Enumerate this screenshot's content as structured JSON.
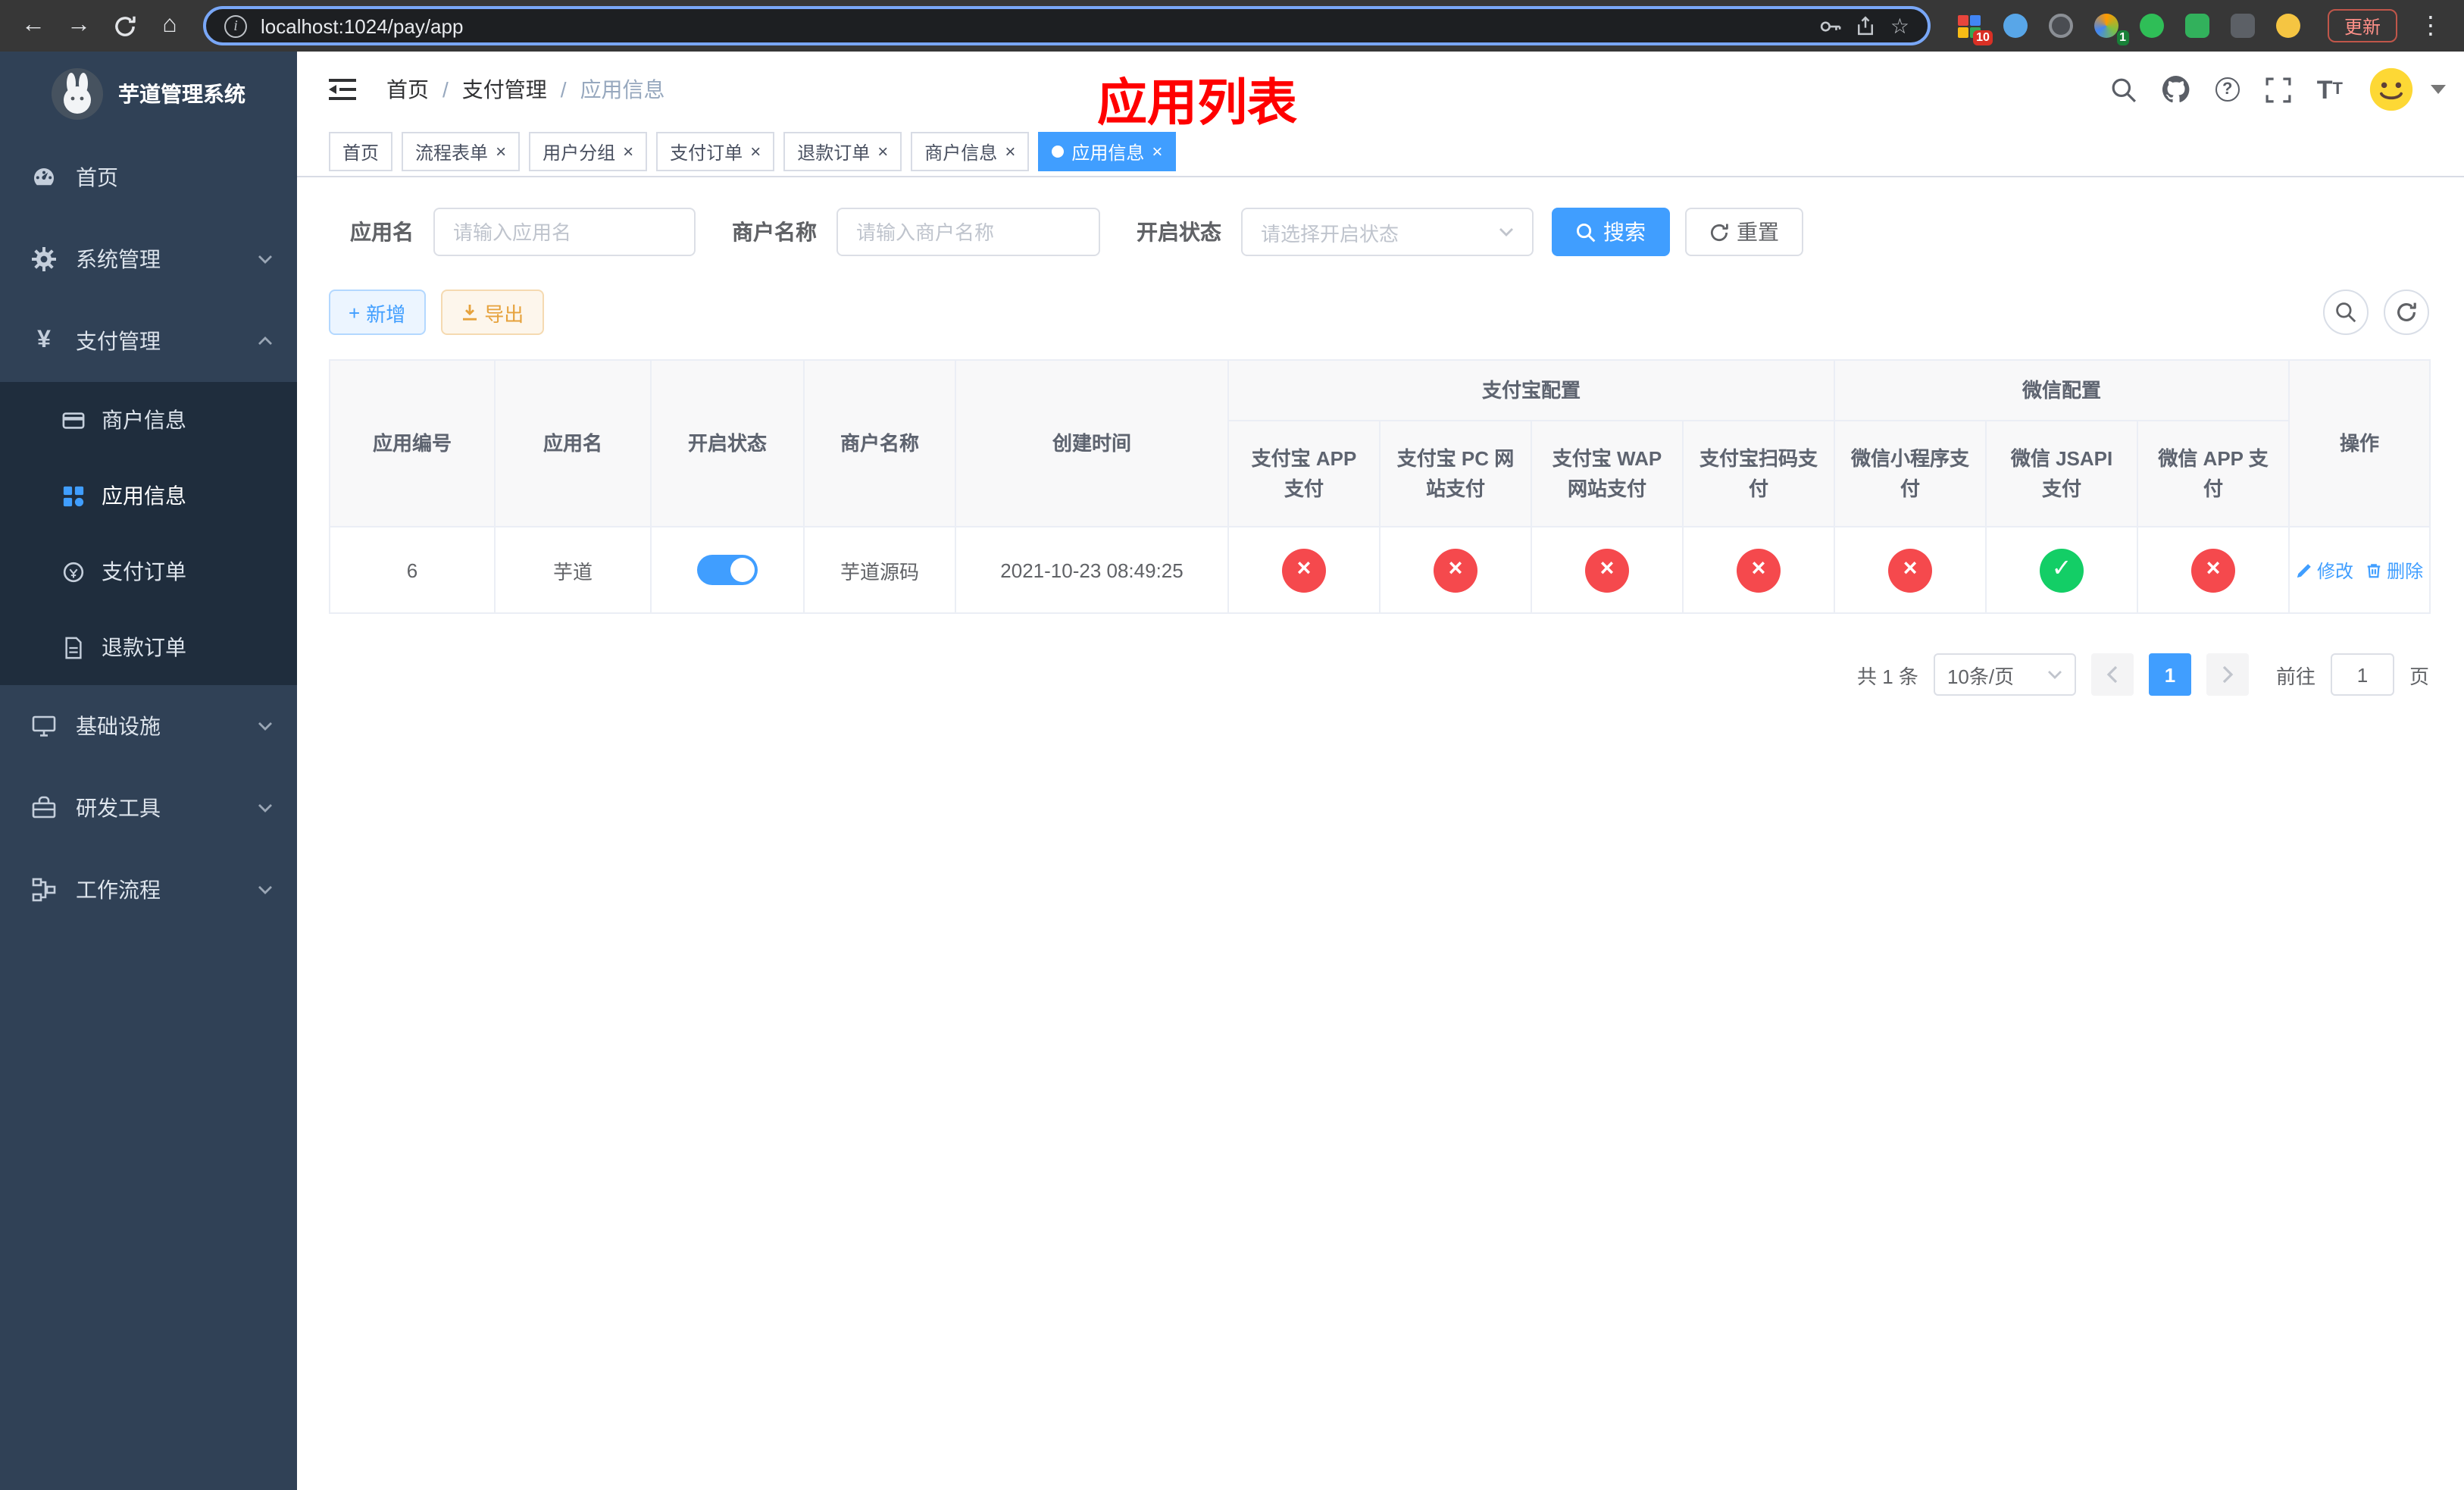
{
  "browser": {
    "url": "localhost:1024/pay/app",
    "update_label": "更新",
    "ext_badge_a": "10",
    "ext_badge_b": "1"
  },
  "colors": {
    "primary": "#409EFF",
    "danger": "#f5494d",
    "success": "#13ce66",
    "sidebar_bg": "#304156",
    "submenu_bg": "#1f2d3d",
    "annotation_red": "#ff0000"
  },
  "sidebar": {
    "title": "芋道管理系统",
    "items": {
      "home": "首页",
      "system": "系统管理",
      "pay": "支付管理",
      "infra": "基础设施",
      "dev": "研发工具",
      "flow": "工作流程"
    },
    "pay_children": {
      "merchant": "商户信息",
      "app": "应用信息",
      "order": "支付订单",
      "refund": "退款订单"
    }
  },
  "navbar": {
    "breadcrumb": [
      "首页",
      "支付管理",
      "应用信息"
    ],
    "overlay_title": "应用列表"
  },
  "tabs": [
    {
      "label": "首页"
    },
    {
      "label": "流程表单"
    },
    {
      "label": "用户分组"
    },
    {
      "label": "支付订单"
    },
    {
      "label": "退款订单"
    },
    {
      "label": "商户信息"
    },
    {
      "label": "应用信息"
    }
  ],
  "filters": {
    "app_name_label": "应用名",
    "app_name_placeholder": "请输入应用名",
    "merchant_label": "商户名称",
    "merchant_placeholder": "请输入商户名称",
    "status_label": "开启状态",
    "status_placeholder": "请选择开启状态",
    "search_label": "搜索",
    "reset_label": "重置"
  },
  "toolbar": {
    "add_label": "新增",
    "export_label": "导出"
  },
  "table": {
    "groups": {
      "alipay": "支付宝配置",
      "wechat": "微信配置"
    },
    "columns": [
      "应用编号",
      "应用名",
      "开启状态",
      "商户名称",
      "创建时间",
      "支付宝 APP 支付",
      "支付宝 PC 网站支付",
      "支付宝 WAP 网站支付",
      "支付宝扫码支付",
      "微信小程序支付",
      "微信 JSAPI 支付",
      "微信 APP 支付",
      "操作"
    ],
    "row": {
      "id": "6",
      "name": "芋道",
      "enabled": true,
      "merchant": "芋道源码",
      "created": "2021-10-23 08:49:25",
      "statuses": [
        false,
        false,
        false,
        false,
        false,
        true,
        false
      ]
    },
    "edit_label": "修改",
    "delete_label": "删除"
  },
  "pagination": {
    "total": "共 1 条",
    "page_size": "10条/页",
    "page": "1",
    "goto_label": "前往",
    "goto_value": "1",
    "unit_label": "页"
  }
}
